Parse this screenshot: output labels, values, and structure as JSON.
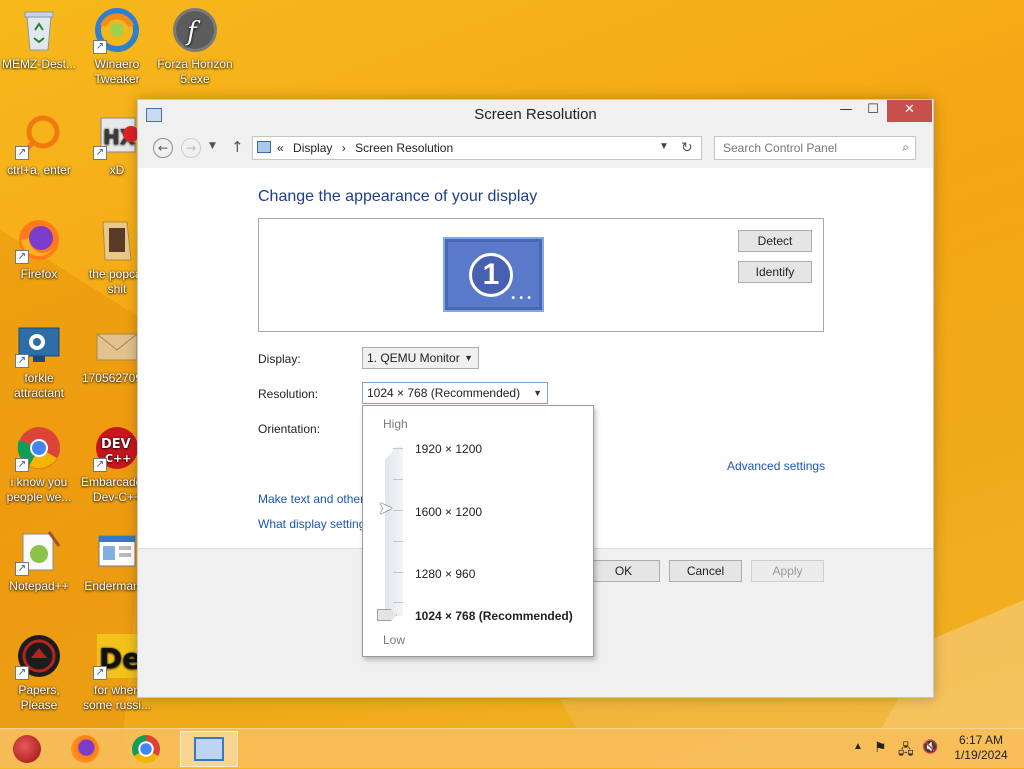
{
  "desktop": {
    "icons": [
      {
        "label": "MEMZ-Dest...",
        "icon": "recycle-bin-icon"
      },
      {
        "label": "Winaero Tweaker",
        "icon": "winaero-icon"
      },
      {
        "label": "Forza Horizon 5.exe",
        "icon": "flash-icon"
      },
      {
        "label": "ctrl+a, enter",
        "icon": "search-ring-icon"
      },
      {
        "label": "xD",
        "icon": "hxd-icon"
      },
      {
        "label": "Firefox",
        "icon": "firefox-icon"
      },
      {
        "label": "the popcat shit",
        "icon": "folder-icon"
      },
      {
        "label": "forkie attractant",
        "icon": "monitor-settings-icon"
      },
      {
        "label": "170562709...",
        "icon": "envelope-icon"
      },
      {
        "label": "i know you people we...",
        "icon": "chrome-icon"
      },
      {
        "label": "Embarcadero Dev-C++",
        "icon": "devcpp-icon"
      },
      {
        "label": "Notepad++",
        "icon": "notepadpp-icon"
      },
      {
        "label": "Enderman...",
        "icon": "window-app-icon"
      },
      {
        "label": "Papers, Please",
        "icon": "papers-please-icon"
      },
      {
        "label": "for when some russi...",
        "icon": "dex-icon"
      }
    ]
  },
  "window": {
    "title": "Screen Resolution",
    "controls": {
      "minimize": "—",
      "maximize": "☐",
      "close": "✕"
    },
    "address": {
      "prefix": "«",
      "crumbs": [
        "Display",
        "Screen Resolution"
      ],
      "sep": "›"
    },
    "search_placeholder": "Search Control Panel",
    "heading": "Change the appearance of your display",
    "monitor_number": "1",
    "detect_label": "Detect",
    "identify_label": "Identify",
    "display_label": "Display:",
    "display_value": "1. QEMU Monitor",
    "resolution_label": "Resolution:",
    "resolution_value": "1024 × 768 (Recommended)",
    "orientation_label": "Orientation:",
    "advanced_link": "Advanced settings",
    "link_text_size": "Make text and other",
    "link_display_settings": "What display setting",
    "ok_label": "OK",
    "cancel_label": "Cancel",
    "apply_label": "Apply"
  },
  "resolution_popup": {
    "high_label": "High",
    "low_label": "Low",
    "options": [
      "1920 × 1200",
      "1600 × 1200",
      "1280 × 960",
      "1024 × 768 (Recommended)"
    ],
    "selected_index": 3
  },
  "taskbar": {
    "apps": [
      "ornament-icon",
      "firefox-icon",
      "chrome-icon",
      "control-panel-icon"
    ],
    "clock_time": "6:17 AM",
    "clock_date": "1/19/2024"
  },
  "colors": {
    "desktop_bg": "#f4a514",
    "heading": "#1e3d8f",
    "link": "#1a55b8",
    "close_button": "#c7504c"
  }
}
